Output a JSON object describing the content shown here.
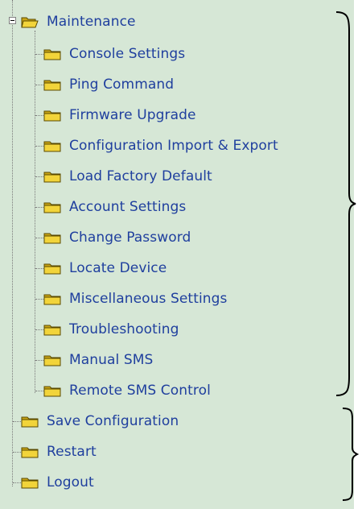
{
  "tree": {
    "root": {
      "label": "Maintenance",
      "expanded": true
    },
    "children": [
      "Console Settings",
      "Ping Command",
      "Firmware Upgrade",
      "Configuration Import & Export",
      "Load Factory Default",
      "Account Settings",
      "Change Password",
      "Locate Device",
      "Miscellaneous Settings",
      "Troubleshooting",
      "Manual SMS",
      "Remote SMS Control"
    ],
    "siblings": [
      "Save Configuration",
      "Restart",
      "Logout"
    ]
  },
  "colors": {
    "panel_bg": "#d6e7d6",
    "link_text": "#1f3f9e",
    "folder_fill": "#e3c21f",
    "folder_outline": "#5a4a00"
  },
  "icons": {
    "folder_closed": "folder-icon",
    "folder_open": "folder-open-icon",
    "expander": "collapse-minus-icon"
  }
}
